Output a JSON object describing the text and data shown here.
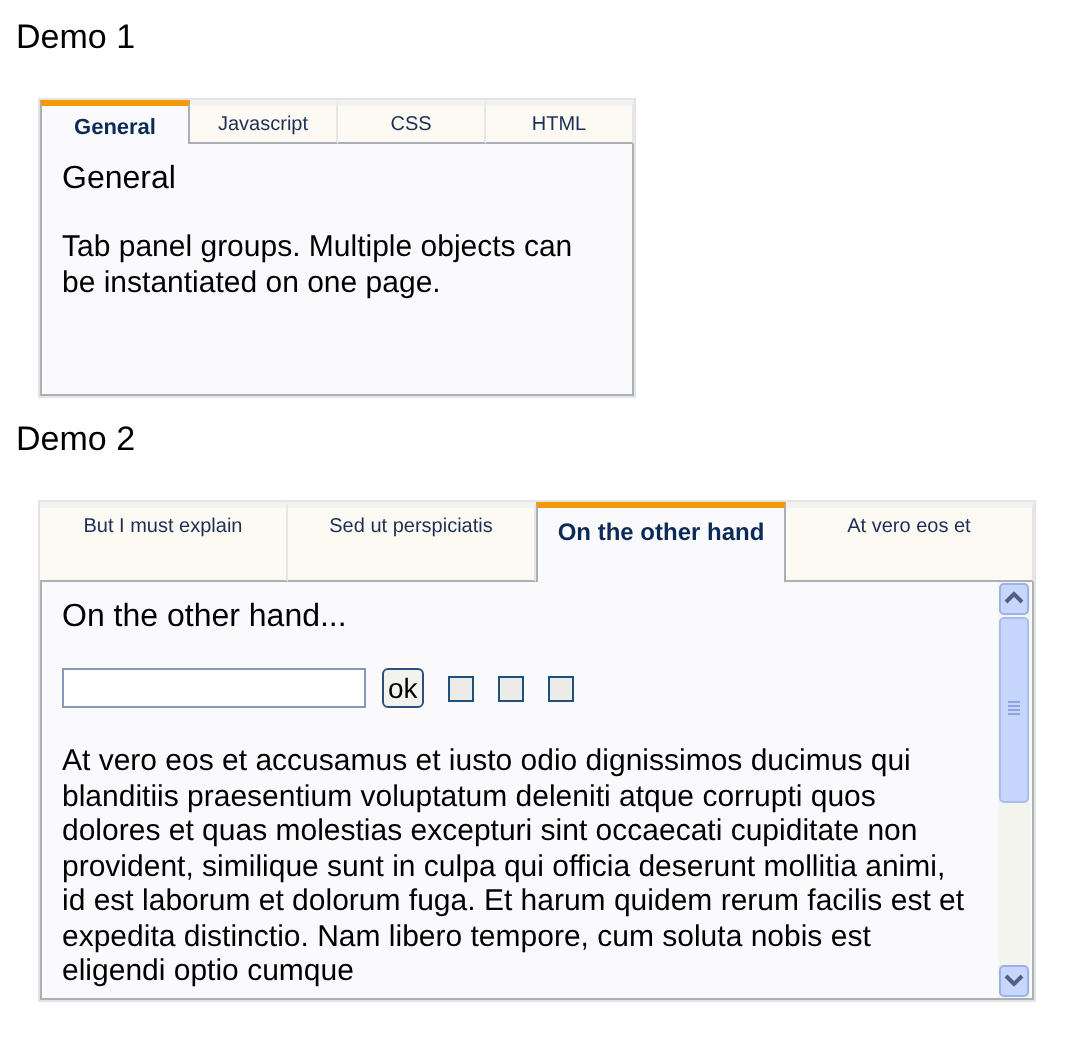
{
  "demos": [
    {
      "heading": "Demo 1",
      "tabs": [
        {
          "label": "General",
          "selected": true
        },
        {
          "label": "Javascript",
          "selected": false
        },
        {
          "label": "CSS",
          "selected": false
        },
        {
          "label": "HTML",
          "selected": false
        }
      ],
      "panel": {
        "title": "General",
        "text": "Tab panel groups. Multiple objects can be instantiated on one page."
      }
    },
    {
      "heading": "Demo 2",
      "tabs": [
        {
          "label": "But I must explain",
          "selected": false
        },
        {
          "label": "Sed ut perspiciatis",
          "selected": false
        },
        {
          "label": "On the other hand",
          "selected": true
        },
        {
          "label": "At vero eos et",
          "selected": false
        }
      ],
      "panel": {
        "title": "On the other hand...",
        "form": {
          "button": "ok",
          "checkboxes": [
            {
              "checked": false
            },
            {
              "checked": false
            },
            {
              "checked": false
            }
          ]
        },
        "text": "At vero eos et accusamus et iusto odio dignissimos ducimus qui blanditiis praesentium voluptatum deleniti atque corrupti quos dolores et quas molestias excepturi sint occaecati cupiditate non provident, similique sunt in culpa qui officia deserunt mollitia animi, id est laborum et dolorum fuga. Et harum quidem rerum facilis est et expedita distinctio. Nam libero tempore, cum soluta nobis est eligendi optio cumque",
        "scrollable": true
      }
    }
  ]
}
